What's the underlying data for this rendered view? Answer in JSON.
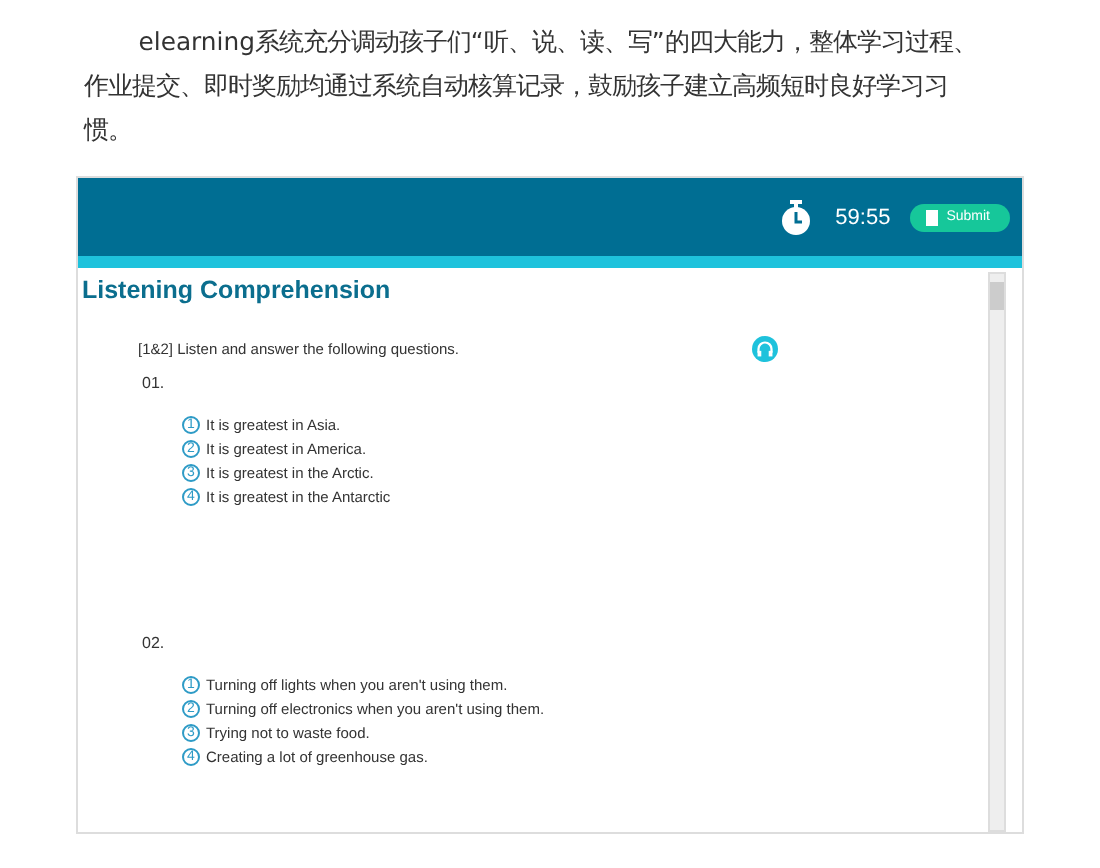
{
  "article": {
    "paragraph": "elearning系统充分调动孩子们“听、说、读、写”的四大能力，整体学习过程、作业提交、即时奖励均通过系统自动核算记录，鼓励孩子建立高频短时良好学习习惯。"
  },
  "screenshot": {
    "timer": "59:55",
    "submit": "Submit",
    "section_title": "Listening Comprehension",
    "instruction": "[1&2] Listen and answer the following questions.",
    "questions": [
      {
        "number": "01.",
        "options": [
          {
            "number": "1",
            "text": "It is greatest in Asia."
          },
          {
            "number": "2",
            "text": "It is greatest in America."
          },
          {
            "number": "3",
            "text": "It is greatest in the Arctic."
          },
          {
            "number": "4",
            "text": "It is greatest in the Antarctic"
          }
        ]
      },
      {
        "number": "02.",
        "options": [
          {
            "number": "1",
            "text": "Turning off lights when you aren't using them."
          },
          {
            "number": "2",
            "text": "Turning off electronics when you aren't using them."
          },
          {
            "number": "3",
            "text": "Trying not to waste food."
          },
          {
            "number": "4",
            "text": "Creating a lot of greenhouse gas."
          }
        ]
      }
    ]
  }
}
